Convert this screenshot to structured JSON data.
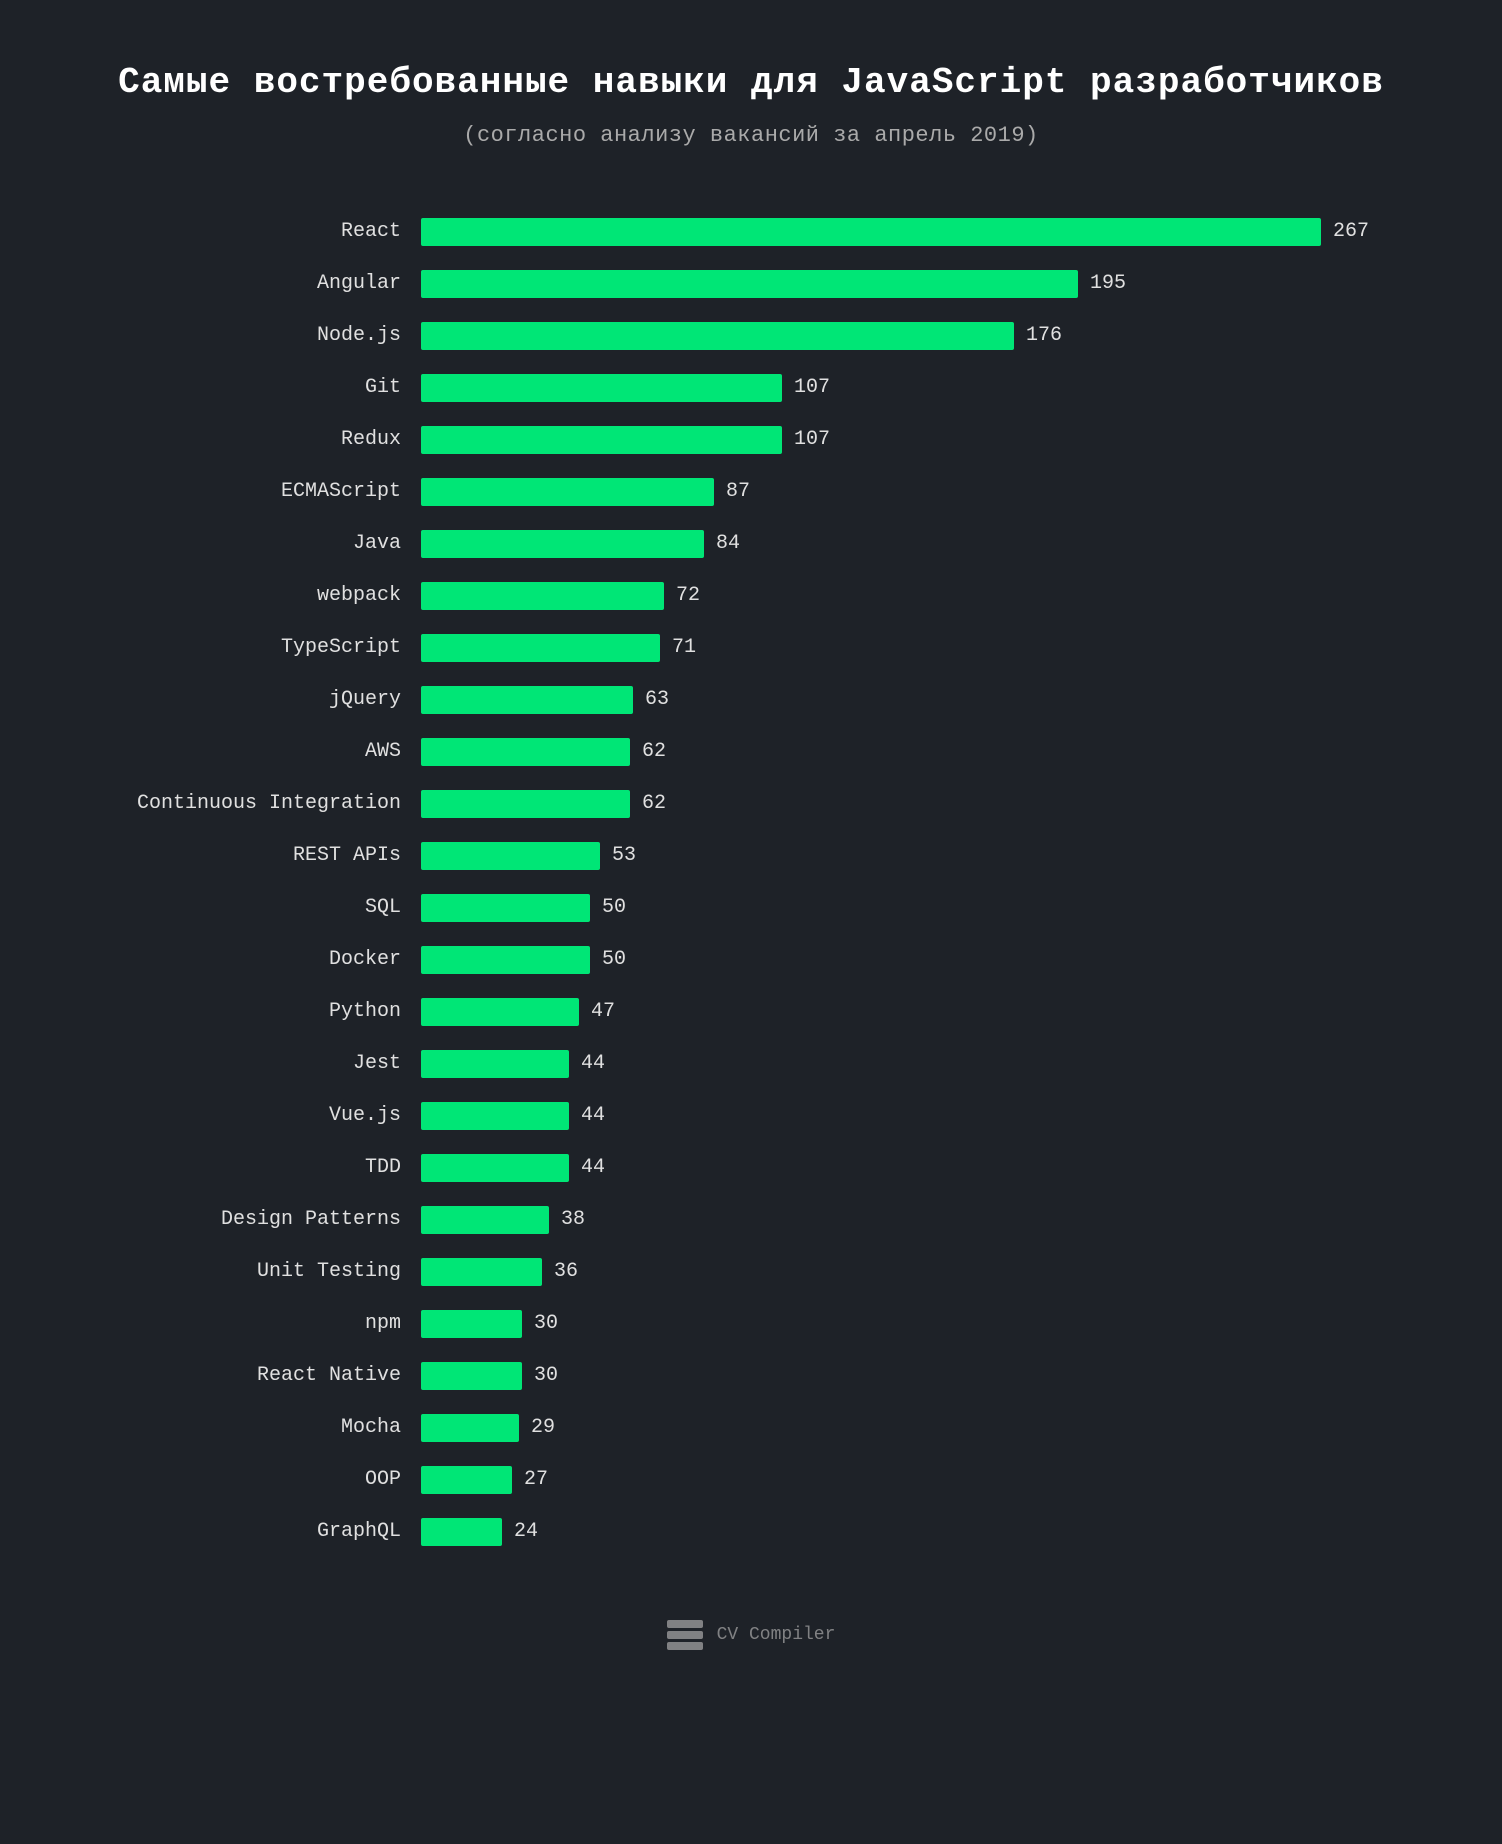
{
  "title": "Самые востребованные навыки для JavaScript разработчиков",
  "subtitle": "(согласно анализу вакансий за апрель 2019)",
  "footer": {
    "brand": "CV Compiler"
  },
  "chart": {
    "max_value": 267,
    "max_bar_width": 900,
    "bars": [
      {
        "label": "React",
        "value": 267
      },
      {
        "label": "Angular",
        "value": 195
      },
      {
        "label": "Node.js",
        "value": 176
      },
      {
        "label": "Git",
        "value": 107
      },
      {
        "label": "Redux",
        "value": 107
      },
      {
        "label": "ECMAScript",
        "value": 87
      },
      {
        "label": "Java",
        "value": 84
      },
      {
        "label": "webpack",
        "value": 72
      },
      {
        "label": "TypeScript",
        "value": 71
      },
      {
        "label": "jQuery",
        "value": 63
      },
      {
        "label": "AWS",
        "value": 62
      },
      {
        "label": "Continuous Integration",
        "value": 62
      },
      {
        "label": "REST APIs",
        "value": 53
      },
      {
        "label": "SQL",
        "value": 50
      },
      {
        "label": "Docker",
        "value": 50
      },
      {
        "label": "Python",
        "value": 47
      },
      {
        "label": "Jest",
        "value": 44
      },
      {
        "label": "Vue.js",
        "value": 44
      },
      {
        "label": "TDD",
        "value": 44
      },
      {
        "label": "Design Patterns",
        "value": 38
      },
      {
        "label": "Unit Testing",
        "value": 36
      },
      {
        "label": "npm",
        "value": 30
      },
      {
        "label": "React Native",
        "value": 30
      },
      {
        "label": "Mocha",
        "value": 29
      },
      {
        "label": "OOP",
        "value": 27
      },
      {
        "label": "GraphQL",
        "value": 24
      }
    ]
  }
}
